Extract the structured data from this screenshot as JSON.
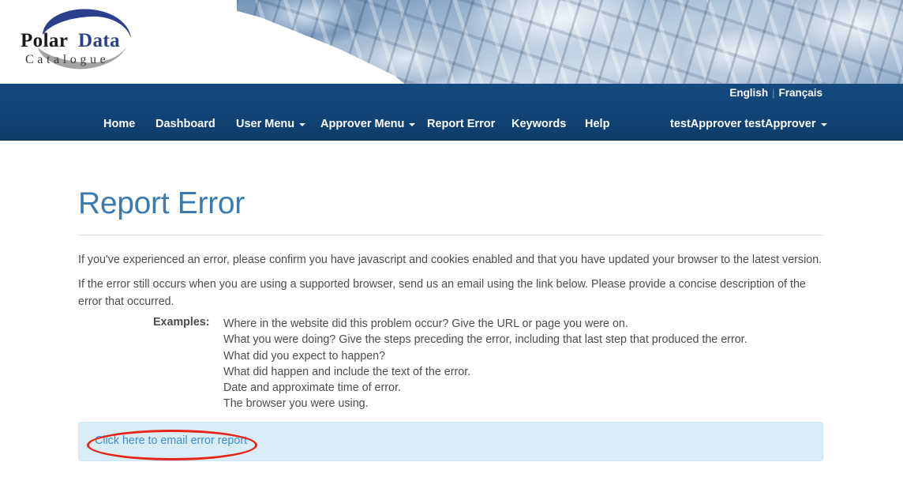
{
  "banner": {
    "logo": {
      "line1_part1": "Polar",
      "line1_part2": "Data",
      "line2": "Catalogue",
      "alt": "Polar Data Catalogue logo",
      "swoosh_top_color": "#2b3f8c",
      "swoosh_bottom_color": "#9a9a9a"
    },
    "photo_alt": "Glacier ice banner photograph"
  },
  "navbar": {
    "background_color": "#124678",
    "languages": [
      {
        "label": "English",
        "active": true
      },
      {
        "label": "Français",
        "active": false
      }
    ],
    "language_separator": "|",
    "items": [
      {
        "label": "Home",
        "has_caret": false
      },
      {
        "label": "Dashboard",
        "has_caret": false
      },
      {
        "label": "User Menu",
        "has_caret": true
      },
      {
        "label": "Approver Menu",
        "has_caret": true
      },
      {
        "label": "Report Error",
        "has_caret": false
      },
      {
        "label": "Keywords",
        "has_caret": false
      },
      {
        "label": "Help",
        "has_caret": false
      }
    ],
    "user": {
      "label": "testApprover testApprover",
      "has_caret": true
    }
  },
  "main": {
    "title": "Report Error",
    "title_color": "#3b7bad",
    "paragraph_1": "If you've experienced an error, please confirm you have javascript and cookies enabled and that you have updated your browser to the latest version.",
    "paragraph_2": "If the error still occurs when you are using a supported browser, send us an email using the link below. Please provide a concise description of the error that occurred.",
    "examples_label": "Examples:",
    "examples": [
      "Where in the website did this problem occur? Give the URL or page you were on.",
      "What you were doing? Give the steps preceding the error, including that last step that produced the error.",
      "What did you expect to happen?",
      "What did happen and include the text of the error.",
      "Date and approximate time of error.",
      "The browser you were using."
    ],
    "alert": {
      "link_label": "Click here to email error report",
      "background_color": "#d9edf7",
      "link_color": "#3b8ed0"
    }
  },
  "annotation": {
    "shape": "ellipse",
    "color": "#e8231a",
    "target": "Click here to email error report"
  }
}
